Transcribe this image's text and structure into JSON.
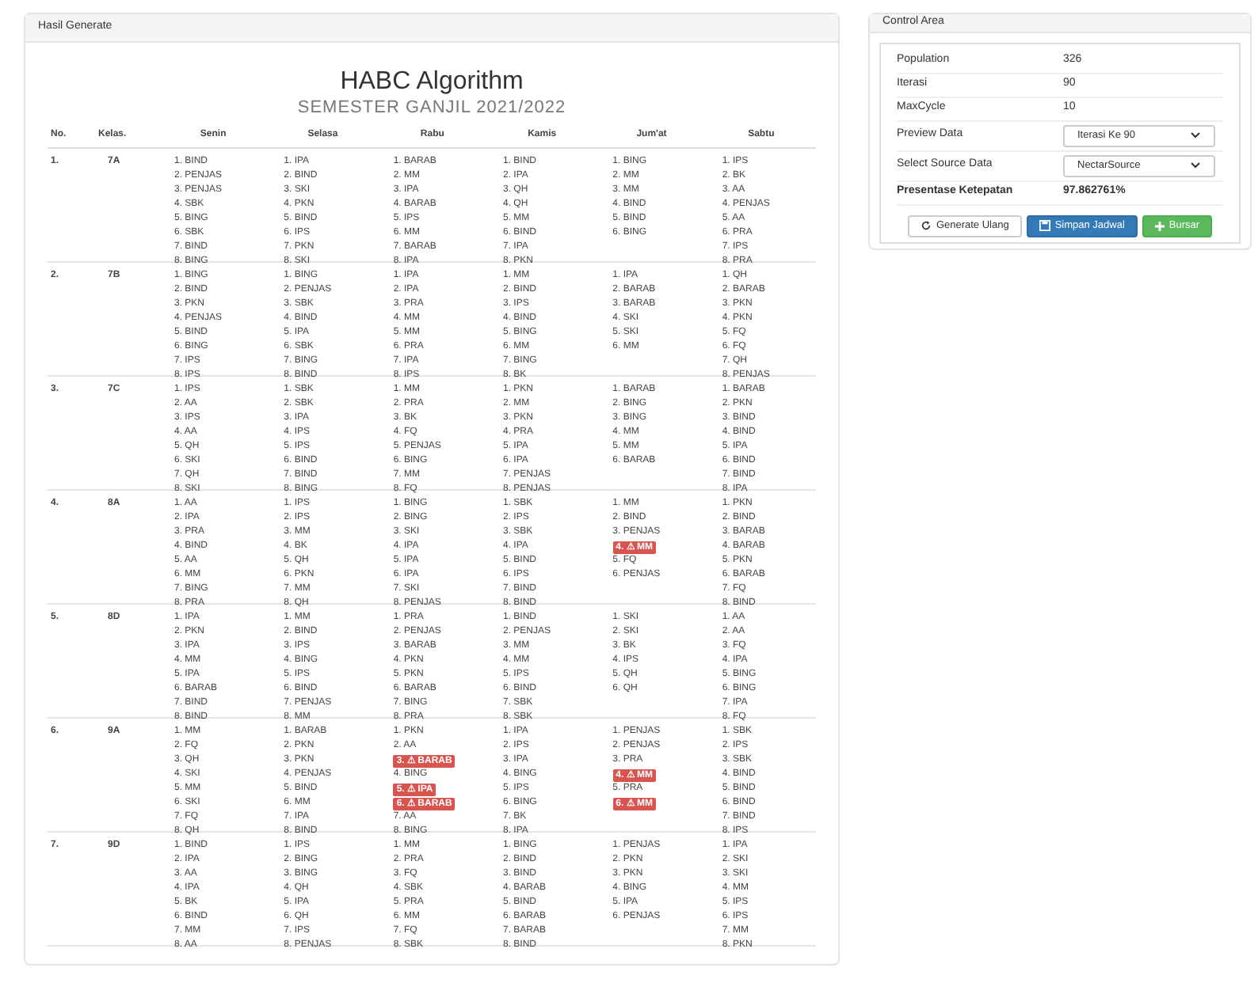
{
  "left_panel": {
    "title": "Hasil Generate",
    "heading": "HABC Algorithm",
    "subheading": "SEMESTER GANJIL 2021/2022",
    "table": {
      "columns": [
        "No.",
        "Kelas.",
        "Senin",
        "Selasa",
        "Rabu",
        "Kamis",
        "Jum'at",
        "Sabtu"
      ],
      "rows": [
        {
          "no": "1.",
          "kelas": "7A",
          "days": [
            [
              "1. BIND",
              "2. PENJAS",
              "3. PENJAS",
              "4. SBK",
              "5. BING",
              "6. SBK",
              "7. BIND",
              "8. BING"
            ],
            [
              "1. IPA",
              "2. BIND",
              "3. SKI",
              "4. PKN",
              "5. BIND",
              "6. IPS",
              "7. PKN",
              "8. SKI"
            ],
            [
              "1. BARAB",
              "2. MM",
              "3. IPA",
              "4. BARAB",
              "5. IPS",
              "6. MM",
              "7. BARAB",
              "8. IPA"
            ],
            [
              "1. BIND",
              "2. IPA",
              "3. QH",
              "4. QH",
              "5. MM",
              "6. BIND",
              "7. IPA",
              "8. PKN"
            ],
            [
              "1. BING",
              "2. MM",
              "3. MM",
              "4. BIND",
              "5. BIND",
              "6. BING"
            ],
            [
              "1. IPS",
              "2. BK",
              "3. AA",
              "4. PENJAS",
              "5. AA",
              "6. PRA",
              "7. IPS",
              "8. PRA"
            ]
          ]
        },
        {
          "no": "2.",
          "kelas": "7B",
          "days": [
            [
              "1. BING",
              "2. BIND",
              "3. PKN",
              "4. PENJAS",
              "5. BIND",
              "6. BING",
              "7. IPS",
              "8. IPS"
            ],
            [
              "1. BING",
              "2. PENJAS",
              "3. SBK",
              "4. BIND",
              "5. IPA",
              "6. SBK",
              "7. BING",
              "8. BIND"
            ],
            [
              "1. IPA",
              "2. IPA",
              "3. PRA",
              "4. MM",
              "5. MM",
              "6. PRA",
              "7. IPA",
              "8. IPS"
            ],
            [
              "1. MM",
              "2. BIND",
              "3. IPS",
              "4. BIND",
              "5. BING",
              "6. MM",
              "7. BING",
              "8. BK"
            ],
            [
              "1. IPA",
              "2. BARAB",
              "3. BARAB",
              "4. SKI",
              "5. SKI",
              "6. MM"
            ],
            [
              "1. QH",
              "2. BARAB",
              "3. PKN",
              "4. PKN",
              "5. FQ",
              "6. FQ",
              "7. QH",
              "8. PENJAS"
            ]
          ]
        },
        {
          "no": "3.",
          "kelas": "7C",
          "days": [
            [
              "1. IPS",
              "2. AA",
              "3. IPS",
              "4. AA",
              "5. QH",
              "6. SKI",
              "7. QH",
              "8. SKI"
            ],
            [
              "1. SBK",
              "2. SBK",
              "3. IPA",
              "4. IPS",
              "5. IPS",
              "6. BIND",
              "7. BIND",
              "8. BING"
            ],
            [
              "1. MM",
              "2. PRA",
              "3. BK",
              "4. FQ",
              "5. PENJAS",
              "6. BING",
              "7. MM",
              "8. FQ"
            ],
            [
              "1. PKN",
              "2. MM",
              "3. PKN",
              "4. PRA",
              "5. IPA",
              "6. IPA",
              "7. PENJAS",
              "8. PENJAS"
            ],
            [
              "1. BARAB",
              "2. BING",
              "3. BING",
              "4. MM",
              "5. MM",
              "6. BARAB"
            ],
            [
              "1. BARAB",
              "2. PKN",
              "3. BIND",
              "4. BIND",
              "5. IPA",
              "6. BIND",
              "7. BIND",
              "8. IPA"
            ]
          ]
        },
        {
          "no": "4.",
          "kelas": "8A",
          "days": [
            [
              "1. AA",
              "2. IPA",
              "3. PRA",
              "4. BIND",
              "5. AA",
              "6. MM",
              "7. BING",
              "8. PRA"
            ],
            [
              "1. IPS",
              "2. IPS",
              "3. MM",
              "4. BK",
              "5. QH",
              "6. PKN",
              "7. MM",
              "8. QH"
            ],
            [
              "1. BING",
              "2. BING",
              "3. SKI",
              "4. IPA",
              "5. IPA",
              "6. IPA",
              "7. SKI",
              "8. PENJAS"
            ],
            [
              "1. SBK",
              "2. IPS",
              "3. SBK",
              "4. IPA",
              "5. BIND",
              "6. IPS",
              "7. BIND",
              "8. BIND"
            ],
            [
              "1. MM",
              "2. BIND",
              "3. PENJAS",
              {
                "text": "4. ⚠ MM",
                "kind": "conflict"
              },
              "5. FQ",
              "6. PENJAS"
            ],
            [
              "1. PKN",
              "2. BIND",
              "3. BARAB",
              "4. BARAB",
              "5. PKN",
              "6. BARAB",
              "7. FQ",
              "8. BIND"
            ]
          ]
        },
        {
          "no": "5.",
          "kelas": "8D",
          "days": [
            [
              "1. IPA",
              "2. PKN",
              "3. IPA",
              "4. MM",
              "5. IPA",
              "6. BARAB",
              "7. BIND",
              "8. BIND"
            ],
            [
              "1. MM",
              "2. BIND",
              "3. IPS",
              "4. BING",
              "5. IPS",
              "6. BIND",
              "7. PENJAS",
              "8. MM"
            ],
            [
              "1. PRA",
              "2. PENJAS",
              "3. BARAB",
              "4. PKN",
              "5. PKN",
              "6. BARAB",
              "7. BING",
              "8. PRA"
            ],
            [
              "1. BIND",
              "2. PENJAS",
              "3. MM",
              "4. MM",
              "5. IPS",
              "6. BIND",
              "7. SBK",
              "8. SBK"
            ],
            [
              "1. SKI",
              "2. SKI",
              "3. BK",
              "4. IPS",
              "5. QH",
              "6. QH"
            ],
            [
              "1. AA",
              "2. AA",
              "3. FQ",
              "4. IPA",
              "5. BING",
              "6. BING",
              "7. IPA",
              "8. FQ"
            ]
          ]
        },
        {
          "no": "6.",
          "kelas": "9A",
          "days": [
            [
              "1. MM",
              "2. FQ",
              "3. QH",
              "4. SKI",
              "5. MM",
              "6. SKI",
              "7. FQ",
              "8. QH"
            ],
            [
              "1. BARAB",
              "2. PKN",
              "3. PKN",
              "4. PENJAS",
              "5. BIND",
              "6. MM",
              "7. IPA",
              "8. BIND"
            ],
            [
              "1. PKN",
              "2. AA",
              {
                "text": "3. ⚠ BARAB",
                "kind": "conflict"
              },
              "4. BING",
              {
                "text": "5. ⚠ IPA",
                "kind": "conflict"
              },
              {
                "text": "6. ⚠ BARAB",
                "kind": "conflict"
              },
              "7. AA",
              "8. BING"
            ],
            [
              "1. IPA",
              "2. IPS",
              "3. IPA",
              "4. BING",
              "5. IPS",
              "6. BING",
              "7. BK",
              "8. IPA"
            ],
            [
              "1. PENJAS",
              "2. PENJAS",
              "3. PRA",
              {
                "text": "4. ⚠ MM",
                "kind": "conflict"
              },
              "5. PRA",
              {
                "text": "6. ⚠ MM",
                "kind": "conflict"
              }
            ],
            [
              "1. SBK",
              "2. IPS",
              "3. SBK",
              "4. BIND",
              "5. BIND",
              "6. BIND",
              "7. BIND",
              "8. IPS"
            ]
          ]
        },
        {
          "no": "7.",
          "kelas": "9D",
          "days": [
            [
              "1. BIND",
              "2. IPA",
              "3. AA",
              "4. IPA",
              "5. BK",
              "6. BIND",
              "7. MM",
              "8. AA"
            ],
            [
              "1. IPS",
              "2. BING",
              "3. BING",
              "4. QH",
              "5. IPA",
              "6. QH",
              "7. IPS",
              "8. PENJAS"
            ],
            [
              "1. MM",
              "2. PRA",
              "3. FQ",
              "4. SBK",
              "5. PRA",
              "6. MM",
              "7. FQ",
              "8. SBK"
            ],
            [
              "1. BING",
              "2. BIND",
              "3. BIND",
              "4. BARAB",
              "5. BIND",
              "6. BARAB",
              "7. BARAB",
              "8. BIND"
            ],
            [
              "1. PENJAS",
              "2. PKN",
              "3. PKN",
              "4. BING",
              "5. IPA",
              "6. PENJAS"
            ],
            [
              "1. IPA",
              "2. SKI",
              "3. SKI",
              "4. MM",
              "5. IPS",
              "6. IPS",
              "7. MM",
              "8. PKN"
            ]
          ]
        }
      ]
    }
  },
  "control_area": {
    "title": "Control Area",
    "fields": [
      {
        "kind": "text",
        "label": "Population",
        "value": "326"
      },
      {
        "kind": "text",
        "label": "Iterasi",
        "value": "90"
      },
      {
        "kind": "text",
        "label": "MaxCycle",
        "value": "10"
      },
      {
        "kind": "select",
        "label": "Preview Data",
        "value": "Iterasi Ke 90"
      },
      {
        "kind": "select",
        "label": "Select Source Data",
        "value": "NectarSource"
      },
      {
        "kind": "bold",
        "label": "Presentase Ketepatan",
        "value": "97.862761%"
      }
    ],
    "buttons": [
      {
        "kind": "default",
        "label": "Generate Ulang"
      },
      {
        "kind": "primary",
        "label": "Simpan Jadwal"
      },
      {
        "kind": "success",
        "label": "Bursar"
      }
    ]
  }
}
